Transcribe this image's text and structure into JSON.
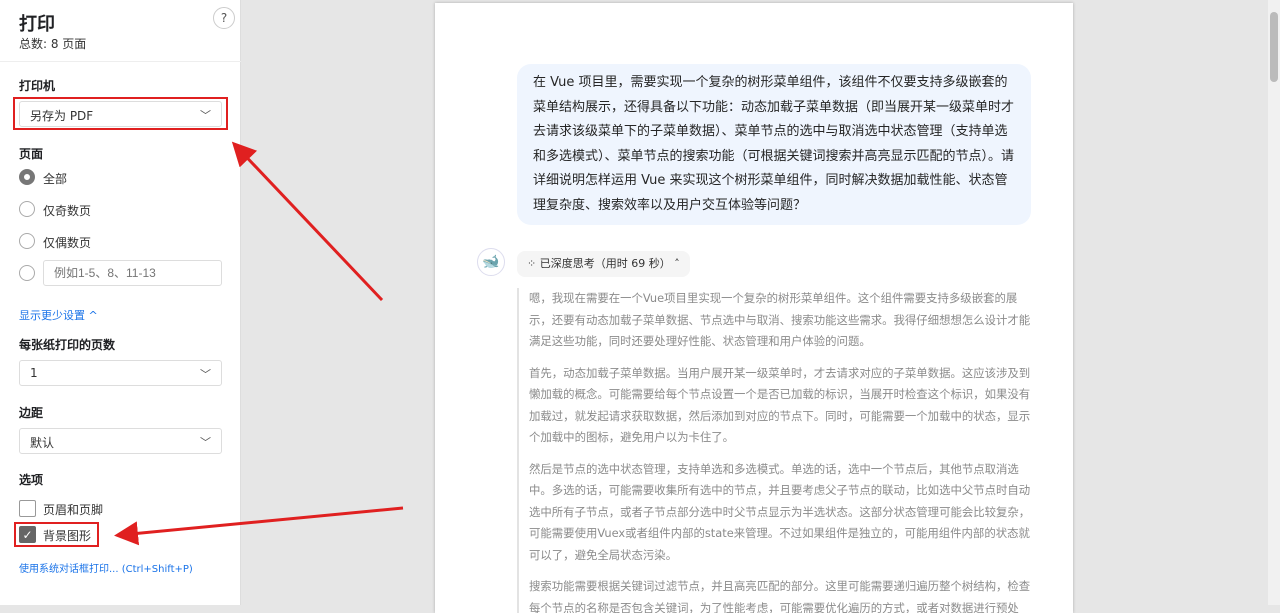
{
  "sidebar": {
    "title": "打印",
    "total": "总数: 8 页面",
    "help": "?",
    "printer_label": "打印机",
    "printer_value": "另存为 PDF",
    "pages_label": "页面",
    "pages_options": [
      "全部",
      "仅奇数页",
      "仅偶数页"
    ],
    "pages_custom_placeholder": "例如1-5、8、11-13",
    "fewer_settings": "显示更少设置 ^",
    "pps_label": "每张纸打印的页数",
    "pps_value": "1",
    "margins_label": "边距",
    "margins_value": "默认",
    "options_label": "选项",
    "options": [
      {
        "label": "页眉和页脚",
        "checked": false
      },
      {
        "label": "背景图形",
        "checked": true
      }
    ],
    "system_dialog": "使用系统对话框打印... (Ctrl+Shift+P)"
  },
  "preview": {
    "user_message": "在 Vue 项目里，需要实现一个复杂的树形菜单组件，该组件不仅要支持多级嵌套的菜单结构展示，还得具备以下功能：动态加载子菜单数据（即当展开某一级菜单时才去请求该级菜单下的子菜单数据）、菜单节点的选中与取消选中状态管理（支持单选和多选模式）、菜单节点的搜索功能（可根据关键词搜索并高亮显示匹配的节点）。请详细说明怎样运用 Vue 来实现这个树形菜单组件，同时解决数据加载性能、状态管理复杂度、搜索效率以及用户交互体验等问题？",
    "thinking_label": "已深度思考（用时 69 秒）",
    "paragraphs": [
      "嗯，我现在需要在一个Vue项目里实现一个复杂的树形菜单组件。这个组件需要支持多级嵌套的展示，还要有动态加载子菜单数据、节点选中与取消、搜索功能这些需求。我得仔细想想怎么设计才能满足这些功能，同时还要处理好性能、状态管理和用户体验的问题。",
      "首先，动态加载子菜单数据。当用户展开某一级菜单时，才去请求对应的子菜单数据。这应该涉及到懒加载的概念。可能需要给每个节点设置一个是否已加载的标识，当展开时检查这个标识，如果没有加载过，就发起请求获取数据，然后添加到对应的节点下。同时，可能需要一个加载中的状态，显示个加载中的图标，避免用户以为卡住了。",
      "然后是节点的选中状态管理，支持单选和多选模式。单选的话，选中一个节点后，其他节点取消选中。多选的话，可能需要收集所有选中的节点，并且要考虑父子节点的联动，比如选中父节点时自动选中所有子节点，或者子节点部分选中时父节点显示为半选状态。这部分状态管理可能会比较复杂，可能需要使用Vuex或者组件内部的state来管理。不过如果组件是独立的，可能用组件内部的状态就可以了，避免全局状态污染。",
      "搜索功能需要根据关键词过滤节点，并且高亮匹配的部分。这里可能需要递归遍历整个树结构，检查每个节点的名称是否包含关键词，为了性能考虑，可能需要优化遍历的方式，或者对数据进行预处"
    ]
  },
  "colors": {
    "annotation": "#e02020",
    "link": "#1a73e8"
  }
}
